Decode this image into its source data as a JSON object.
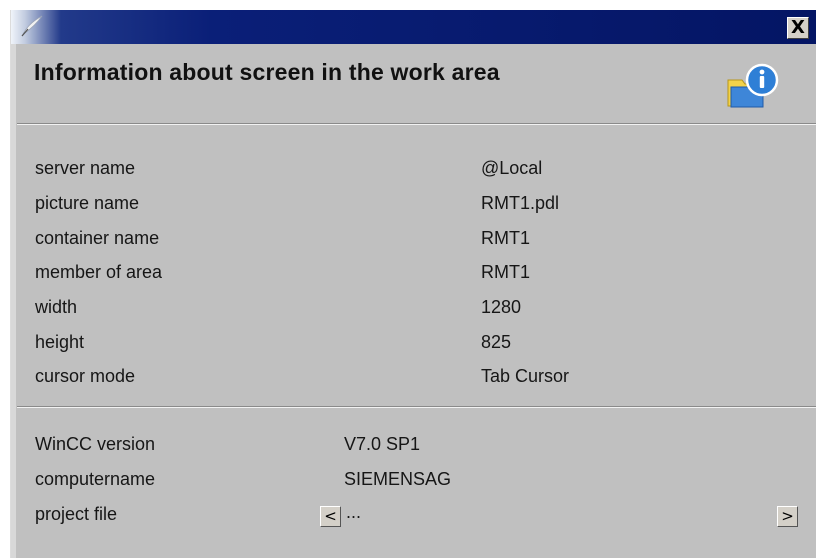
{
  "window": {
    "app_icon": "quill-icon",
    "close_label": "X",
    "heading": "Information about screen in the work area",
    "heading_icon": "info-folder-icon"
  },
  "screen_info": [
    {
      "label": "server name",
      "value": "@Local"
    },
    {
      "label": "picture name",
      "value": "RMT1.pdl"
    },
    {
      "label": "container name",
      "value": "RMT1"
    },
    {
      "label": "member of area",
      "value": "RMT1"
    },
    {
      "label": "width",
      "value": "1280"
    },
    {
      "label": "height",
      "value": "825"
    },
    {
      "label": "cursor mode",
      "value": "Tab Cursor"
    }
  ],
  "system_info": [
    {
      "label": "WinCC version",
      "value": "V7.0 SP1"
    },
    {
      "label": "computername",
      "value": "SIEMENSAG"
    },
    {
      "label": "project file",
      "value": "..."
    }
  ],
  "project_nav": {
    "prev_label": "<",
    "next_label": ">"
  },
  "colors": {
    "title_bar": "#0a1f78",
    "window_bg": "#c0c0c0",
    "info_icon_blue": "#2e7fd6",
    "folder_yellow": "#f2d24a"
  }
}
